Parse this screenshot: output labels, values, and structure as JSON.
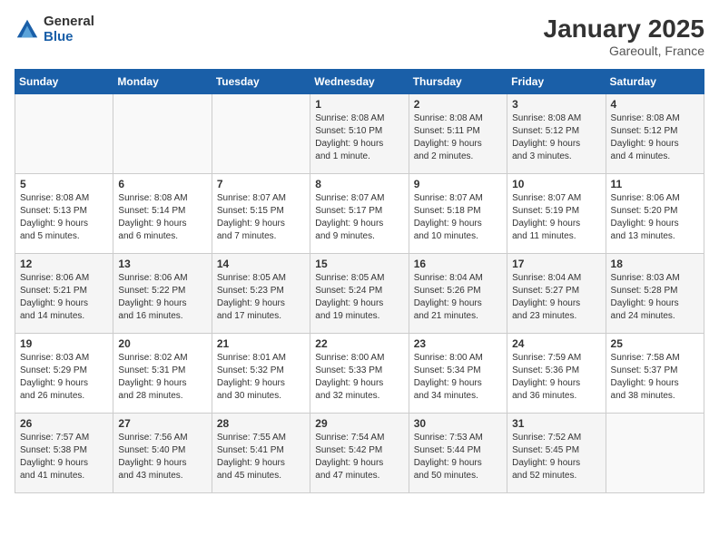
{
  "header": {
    "logo_general": "General",
    "logo_blue": "Blue",
    "title": "January 2025",
    "subtitle": "Gareoult, France"
  },
  "calendar": {
    "headers": [
      "Sunday",
      "Monday",
      "Tuesday",
      "Wednesday",
      "Thursday",
      "Friday",
      "Saturday"
    ],
    "weeks": [
      [
        {
          "day": "",
          "info": ""
        },
        {
          "day": "",
          "info": ""
        },
        {
          "day": "",
          "info": ""
        },
        {
          "day": "1",
          "info": "Sunrise: 8:08 AM\nSunset: 5:10 PM\nDaylight: 9 hours\nand 1 minute."
        },
        {
          "day": "2",
          "info": "Sunrise: 8:08 AM\nSunset: 5:11 PM\nDaylight: 9 hours\nand 2 minutes."
        },
        {
          "day": "3",
          "info": "Sunrise: 8:08 AM\nSunset: 5:12 PM\nDaylight: 9 hours\nand 3 minutes."
        },
        {
          "day": "4",
          "info": "Sunrise: 8:08 AM\nSunset: 5:12 PM\nDaylight: 9 hours\nand 4 minutes."
        }
      ],
      [
        {
          "day": "5",
          "info": "Sunrise: 8:08 AM\nSunset: 5:13 PM\nDaylight: 9 hours\nand 5 minutes."
        },
        {
          "day": "6",
          "info": "Sunrise: 8:08 AM\nSunset: 5:14 PM\nDaylight: 9 hours\nand 6 minutes."
        },
        {
          "day": "7",
          "info": "Sunrise: 8:07 AM\nSunset: 5:15 PM\nDaylight: 9 hours\nand 7 minutes."
        },
        {
          "day": "8",
          "info": "Sunrise: 8:07 AM\nSunset: 5:17 PM\nDaylight: 9 hours\nand 9 minutes."
        },
        {
          "day": "9",
          "info": "Sunrise: 8:07 AM\nSunset: 5:18 PM\nDaylight: 9 hours\nand 10 minutes."
        },
        {
          "day": "10",
          "info": "Sunrise: 8:07 AM\nSunset: 5:19 PM\nDaylight: 9 hours\nand 11 minutes."
        },
        {
          "day": "11",
          "info": "Sunrise: 8:06 AM\nSunset: 5:20 PM\nDaylight: 9 hours\nand 13 minutes."
        }
      ],
      [
        {
          "day": "12",
          "info": "Sunrise: 8:06 AM\nSunset: 5:21 PM\nDaylight: 9 hours\nand 14 minutes."
        },
        {
          "day": "13",
          "info": "Sunrise: 8:06 AM\nSunset: 5:22 PM\nDaylight: 9 hours\nand 16 minutes."
        },
        {
          "day": "14",
          "info": "Sunrise: 8:05 AM\nSunset: 5:23 PM\nDaylight: 9 hours\nand 17 minutes."
        },
        {
          "day": "15",
          "info": "Sunrise: 8:05 AM\nSunset: 5:24 PM\nDaylight: 9 hours\nand 19 minutes."
        },
        {
          "day": "16",
          "info": "Sunrise: 8:04 AM\nSunset: 5:26 PM\nDaylight: 9 hours\nand 21 minutes."
        },
        {
          "day": "17",
          "info": "Sunrise: 8:04 AM\nSunset: 5:27 PM\nDaylight: 9 hours\nand 23 minutes."
        },
        {
          "day": "18",
          "info": "Sunrise: 8:03 AM\nSunset: 5:28 PM\nDaylight: 9 hours\nand 24 minutes."
        }
      ],
      [
        {
          "day": "19",
          "info": "Sunrise: 8:03 AM\nSunset: 5:29 PM\nDaylight: 9 hours\nand 26 minutes."
        },
        {
          "day": "20",
          "info": "Sunrise: 8:02 AM\nSunset: 5:31 PM\nDaylight: 9 hours\nand 28 minutes."
        },
        {
          "day": "21",
          "info": "Sunrise: 8:01 AM\nSunset: 5:32 PM\nDaylight: 9 hours\nand 30 minutes."
        },
        {
          "day": "22",
          "info": "Sunrise: 8:00 AM\nSunset: 5:33 PM\nDaylight: 9 hours\nand 32 minutes."
        },
        {
          "day": "23",
          "info": "Sunrise: 8:00 AM\nSunset: 5:34 PM\nDaylight: 9 hours\nand 34 minutes."
        },
        {
          "day": "24",
          "info": "Sunrise: 7:59 AM\nSunset: 5:36 PM\nDaylight: 9 hours\nand 36 minutes."
        },
        {
          "day": "25",
          "info": "Sunrise: 7:58 AM\nSunset: 5:37 PM\nDaylight: 9 hours\nand 38 minutes."
        }
      ],
      [
        {
          "day": "26",
          "info": "Sunrise: 7:57 AM\nSunset: 5:38 PM\nDaylight: 9 hours\nand 41 minutes."
        },
        {
          "day": "27",
          "info": "Sunrise: 7:56 AM\nSunset: 5:40 PM\nDaylight: 9 hours\nand 43 minutes."
        },
        {
          "day": "28",
          "info": "Sunrise: 7:55 AM\nSunset: 5:41 PM\nDaylight: 9 hours\nand 45 minutes."
        },
        {
          "day": "29",
          "info": "Sunrise: 7:54 AM\nSunset: 5:42 PM\nDaylight: 9 hours\nand 47 minutes."
        },
        {
          "day": "30",
          "info": "Sunrise: 7:53 AM\nSunset: 5:44 PM\nDaylight: 9 hours\nand 50 minutes."
        },
        {
          "day": "31",
          "info": "Sunrise: 7:52 AM\nSunset: 5:45 PM\nDaylight: 9 hours\nand 52 minutes."
        },
        {
          "day": "",
          "info": ""
        }
      ]
    ]
  }
}
